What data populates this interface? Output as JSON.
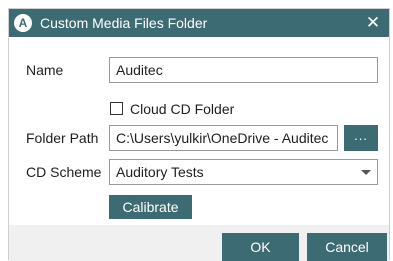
{
  "dialog": {
    "app_icon_letter": "A",
    "title": "Custom Media Files Folder",
    "close_glyph": "✕"
  },
  "form": {
    "name_label": "Name",
    "name_value": "Auditec",
    "cloud_checkbox_label": "Cloud CD Folder",
    "cloud_checkbox_checked": false,
    "folder_path_label": "Folder Path",
    "folder_path_value": "C:\\Users\\yulkir\\OneDrive - Auditec",
    "browse_label": "...",
    "cd_scheme_label": "CD Scheme",
    "cd_scheme_value": "Auditory Tests",
    "calibrate_label": "Calibrate"
  },
  "footer": {
    "ok_label": "OK",
    "cancel_label": "Cancel"
  },
  "colors": {
    "accent": "#3d6b73",
    "panel": "#ffffff",
    "background": "#f0f0f0"
  },
  "icons": {
    "app": "app-logo-icon",
    "close": "close-icon",
    "dropdown": "chevron-down-icon"
  }
}
